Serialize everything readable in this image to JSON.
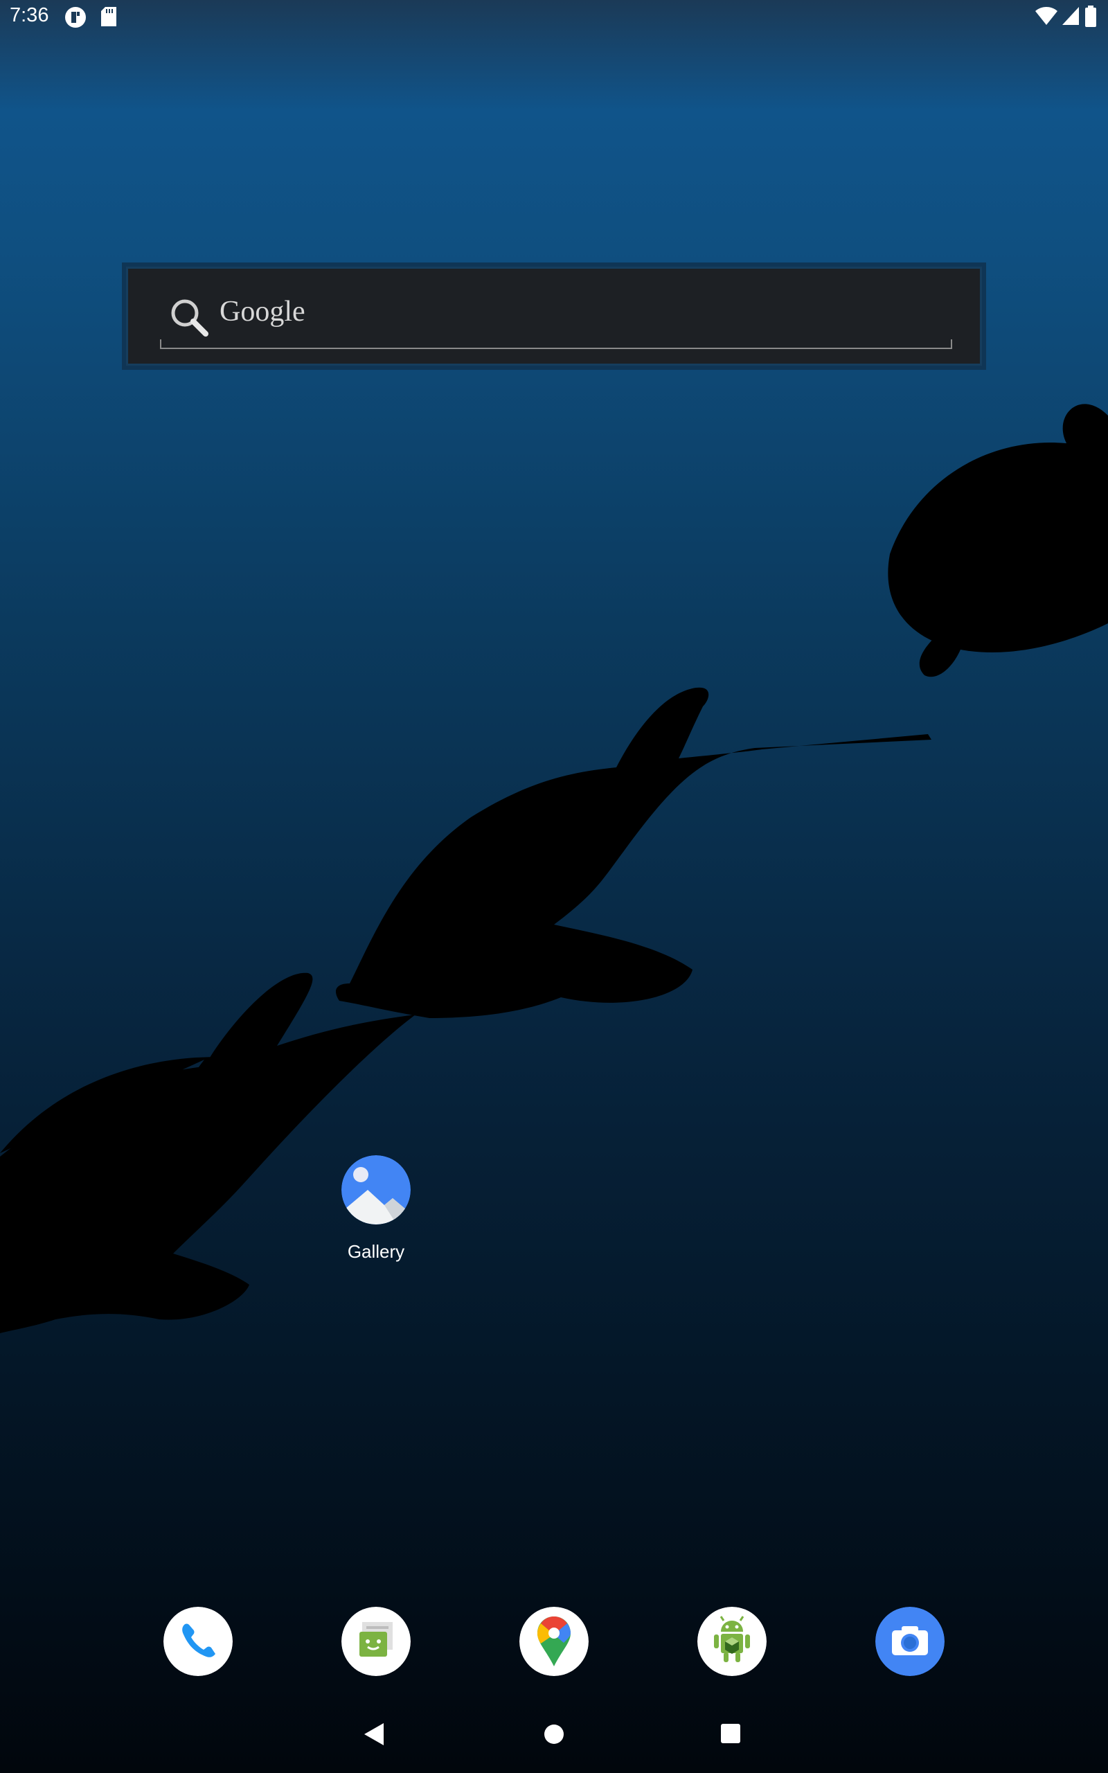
{
  "status_bar": {
    "time": "7:36",
    "left_icons": [
      "app-notification-icon",
      "sd-card-icon"
    ],
    "right_icons": [
      "wifi-icon",
      "cell-signal-icon",
      "battery-icon"
    ]
  },
  "search_widget": {
    "label": "Google",
    "icon": "search-icon"
  },
  "home_apps": [
    {
      "label": "Gallery",
      "icon": "gallery-icon"
    }
  ],
  "dock": [
    {
      "icon": "phone-icon"
    },
    {
      "icon": "messaging-icon"
    },
    {
      "icon": "maps-icon"
    },
    {
      "icon": "android-icon"
    },
    {
      "icon": "camera-icon"
    }
  ],
  "nav_bar": {
    "buttons": [
      "back-icon",
      "home-icon",
      "recents-icon"
    ]
  },
  "colors": {
    "gallery_blue": "#4285f4",
    "phone_blue": "#2196f3",
    "camera_blue": "#4285f4",
    "android_green": "#7cb342"
  }
}
